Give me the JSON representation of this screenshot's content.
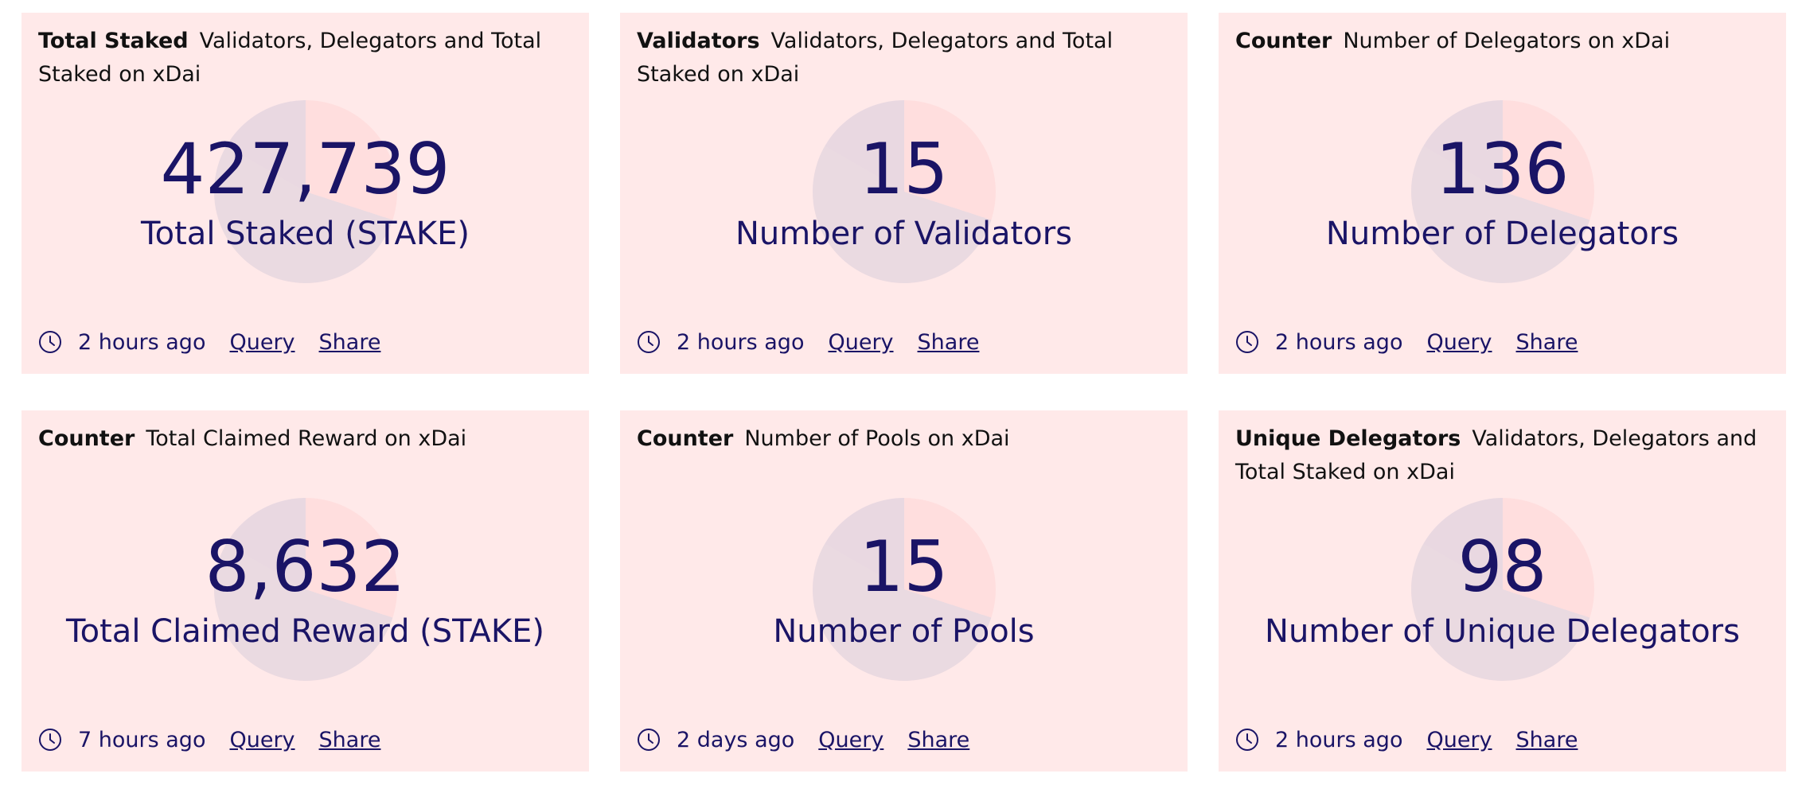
{
  "cards": [
    {
      "kind": "Total Staked",
      "description": "Validators, Delegators and Total Staked on xDai",
      "value": "427,739",
      "label": "Total Staked (STAKE)",
      "time": "2 hours ago",
      "query": "Query",
      "share": "Share"
    },
    {
      "kind": "Validators",
      "description": "Validators, Delegators and Total Staked on xDai",
      "value": "15",
      "label": "Number of Validators",
      "time": "2 hours ago",
      "query": "Query",
      "share": "Share"
    },
    {
      "kind": "Counter",
      "description": "Number of Delegators on xDai",
      "value": "136",
      "label": "Number of Delegators",
      "time": "2 hours ago",
      "query": "Query",
      "share": "Share"
    },
    {
      "kind": "Counter",
      "description": "Total Claimed Reward on xDai",
      "value": "8,632",
      "label": "Total Claimed Reward (STAKE)",
      "time": "7 hours ago",
      "query": "Query",
      "share": "Share"
    },
    {
      "kind": "Counter",
      "description": "Number of Pools on xDai",
      "value": "15",
      "label": "Number of Pools",
      "time": "2 days ago",
      "query": "Query",
      "share": "Share"
    },
    {
      "kind": "Unique Delegators",
      "description": "Validators, Delegators and Total Staked on xDai",
      "value": "98",
      "label": "Number of Unique Delegators",
      "time": "2 hours ago",
      "query": "Query",
      "share": "Share"
    }
  ],
  "colors": {
    "card_background": "#ffe9e9",
    "metric_text": "#1a1466"
  },
  "icons": {
    "footer_time": "clock-icon"
  }
}
